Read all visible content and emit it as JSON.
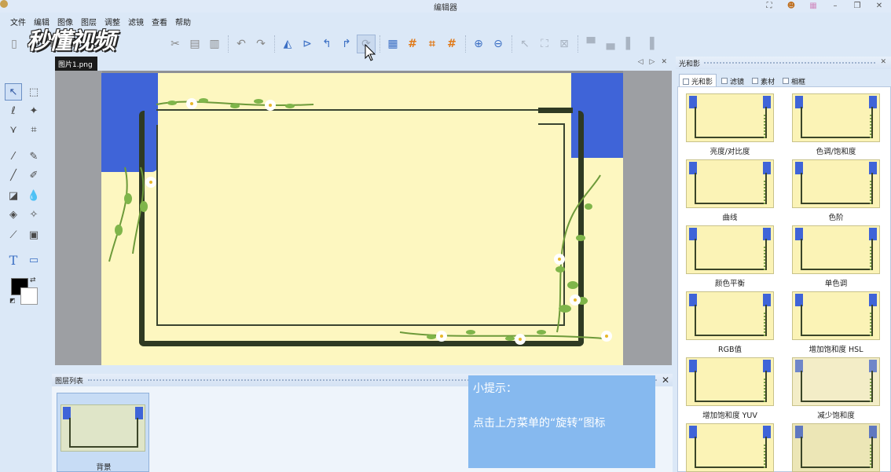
{
  "window": {
    "title": "编辑器"
  },
  "menu": [
    "文件",
    "编辑",
    "图像",
    "图层",
    "调整",
    "滤镜",
    "查看",
    "帮助"
  ],
  "watermark": "秒懂视频",
  "document": {
    "tab_label": "图片1.png"
  },
  "right_panel": {
    "title": "光和影",
    "tabs": [
      "光和影",
      "滤镜",
      "素材",
      "相框"
    ],
    "active_tab": "光和影",
    "effects": [
      "亮度/对比度",
      "色调/饱和度",
      "曲线",
      "色阶",
      "颜色平衡",
      "单色调",
      "RGB值",
      "增加饱和度 HSL",
      "增加饱和度 YUV",
      "减少饱和度",
      "",
      ""
    ]
  },
  "layers_panel": {
    "title": "图层列表",
    "layers": [
      {
        "name": "背景"
      }
    ]
  },
  "tip": {
    "title": "小提示：",
    "body": "点击上方菜单的“旋转”图标"
  },
  "colors": {
    "accent_blue": "#3f64d8",
    "canvas_bg": "#fdf7c0",
    "tip_bg": "#86b9ef",
    "frame": "#2f3a23"
  }
}
